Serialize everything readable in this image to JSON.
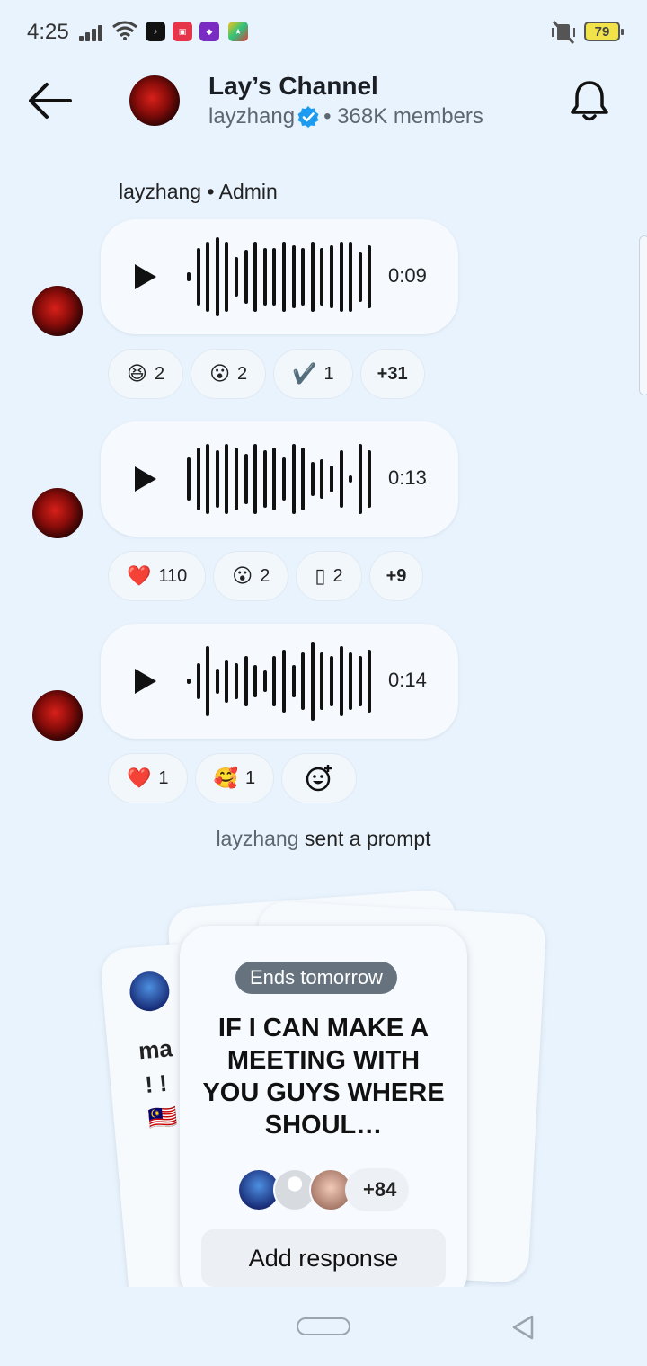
{
  "status_bar": {
    "time": "4:25",
    "battery": "79"
  },
  "header": {
    "title": "Lay’s Channel",
    "handle": "layzhang",
    "members": "• 368K members"
  },
  "sender_line": "layzhang • Admin",
  "messages": [
    {
      "duration": "0:09",
      "reactions": [
        {
          "emoji": "😆",
          "count": "2"
        },
        {
          "emoji": "😮",
          "count": "2"
        },
        {
          "emoji": "✔️",
          "count": "1"
        }
      ],
      "more": "+31"
    },
    {
      "duration": "0:13",
      "reactions": [
        {
          "emoji": "❤️",
          "count": "110"
        },
        {
          "emoji": "😮",
          "count": "2"
        },
        {
          "emoji": "▯",
          "count": "2"
        }
      ],
      "more": "+9"
    },
    {
      "duration": "0:14",
      "reactions": [
        {
          "emoji": "❤️",
          "count": "1"
        },
        {
          "emoji": "🥰",
          "count": "1"
        }
      ]
    }
  ],
  "prompt_note": {
    "who": "layzhang",
    "text": " sent a prompt"
  },
  "prompt_card": {
    "badge": "Ends tomorrow",
    "question": "IF I CAN MAKE A MEETING WITH YOU GUYS WHERE SHOUL…",
    "responder_count": "+84",
    "action": "Add response"
  },
  "back_card": {
    "text1": "ma",
    "text2": "! !",
    "flag": "🇲🇾"
  },
  "icons": {
    "back": "arrow-left-icon",
    "bell": "bell-icon",
    "verified": "verified-badge-icon",
    "play": "play-icon",
    "add_reaction": "add-reaction-icon"
  },
  "colors": {
    "background": "#e9f3fd",
    "verified": "#1d9bf0",
    "badge": "#66737f"
  }
}
